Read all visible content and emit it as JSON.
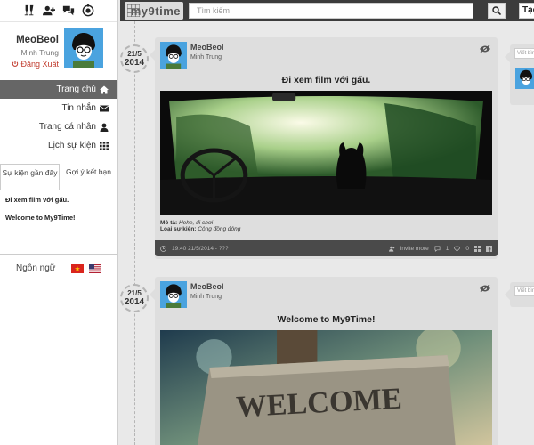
{
  "header": {
    "logo": "my9time",
    "search_placeholder": "Tìm kiếm",
    "create_label": "Tạo"
  },
  "sidebar": {
    "top_icons": [
      "champagne-icon",
      "friend-request-icon",
      "chat-icon",
      "notification-icon"
    ],
    "profile": {
      "username": "MeoBeol",
      "realname": "Minh Trung",
      "logout_label": "Đăng Xuất"
    },
    "menu": [
      {
        "label": "Trang chủ",
        "icon": "home-icon"
      },
      {
        "label": "Tin nhắn",
        "icon": "envelope-icon"
      },
      {
        "label": "Trang cá nhân",
        "icon": "user-icon"
      },
      {
        "label": "Lịch sự kiện",
        "icon": "calendar-grid-icon"
      }
    ],
    "tabs": [
      "Sự kiện gần đây",
      "Gợi ý kết bạn"
    ],
    "recent_events": [
      "Đi xem film với gấu.",
      "Welcome to My9Time!"
    ],
    "language_label": "Ngôn ngữ"
  },
  "posts": [
    {
      "date": "21/5",
      "year": "2014",
      "username": "MeoBeol",
      "realname": "Minh Trung",
      "title": "Đi xem film với gấu.",
      "desc_label": "Mô tả:",
      "desc_value": "Hehe, đi chơi",
      "type_label": "Loại sự kiện:",
      "type_value": "Cộng đồng đông",
      "time_text": "19:40  21/5/2014 - ???",
      "invite_label": "Invite more",
      "comment_count": "1",
      "like_count": "0"
    },
    {
      "date": "21/5",
      "year": "2014",
      "username": "MeoBeol",
      "realname": "Minh Trung",
      "title": "Welcome to My9Time!"
    }
  ],
  "comment_placeholder": "Viết bình luận"
}
